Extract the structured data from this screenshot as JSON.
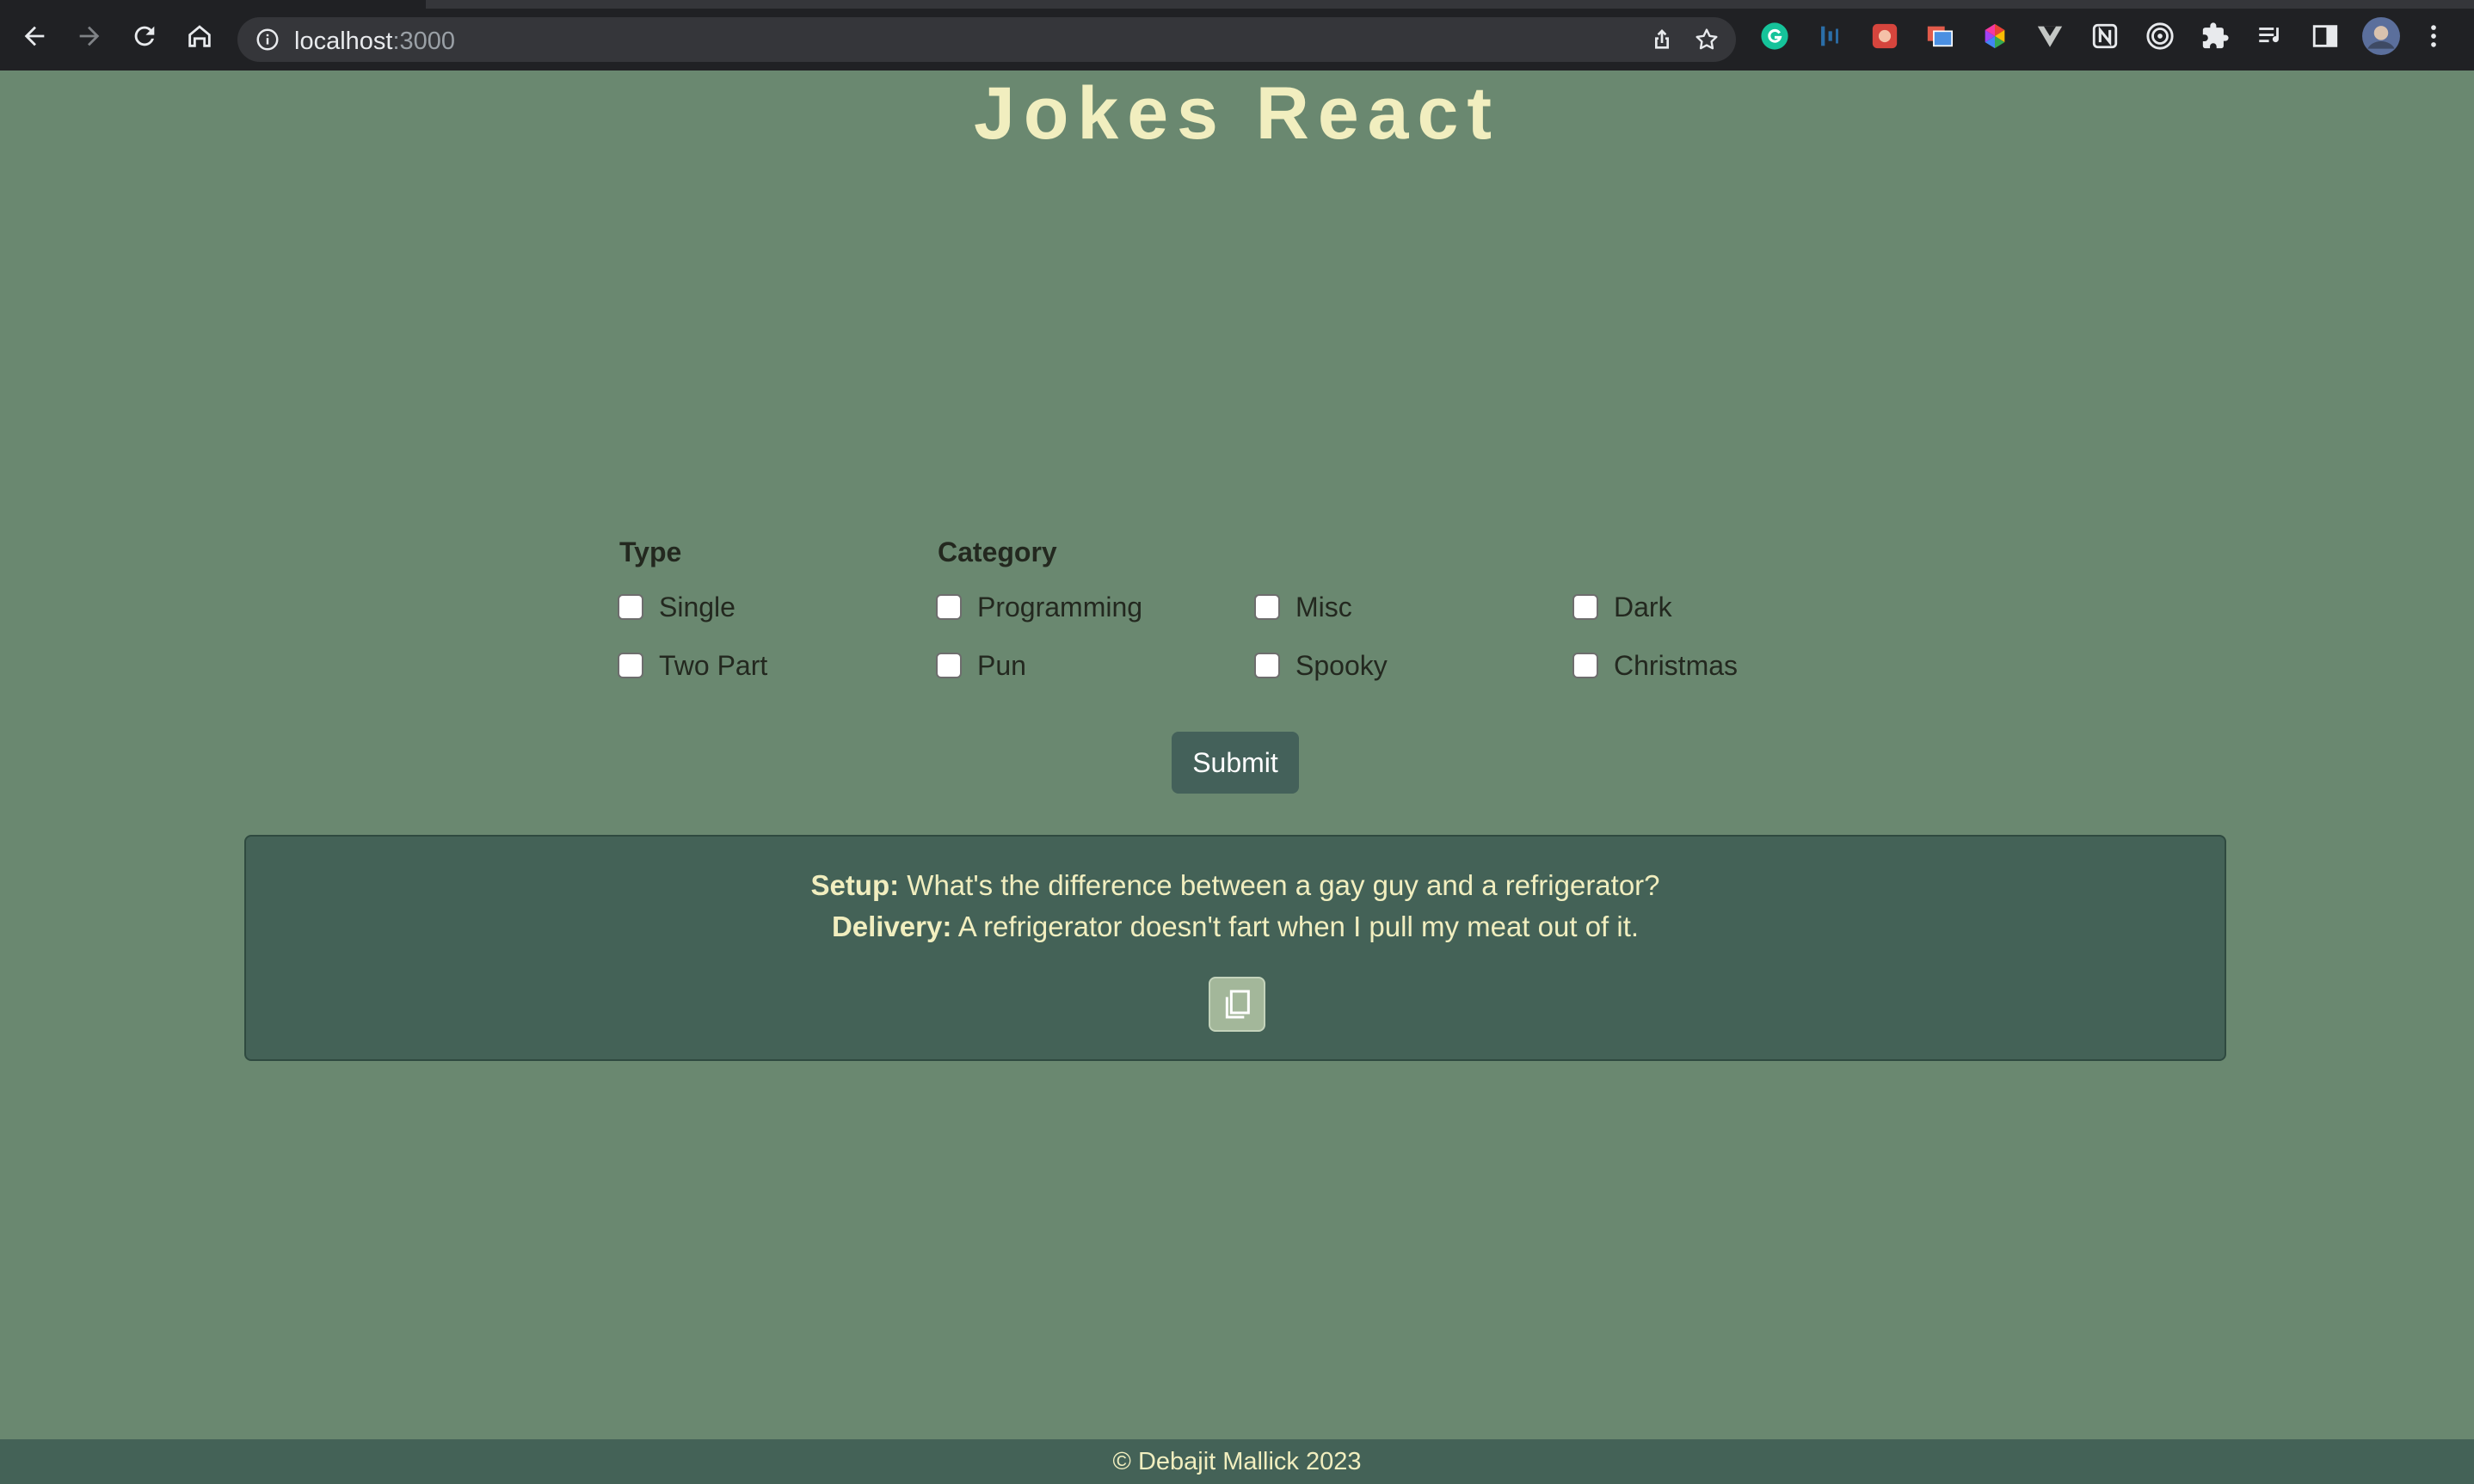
{
  "browser": {
    "url_host": "localhost",
    "url_port": ":3000",
    "extensions": [
      "grammarly-icon",
      "bars-extension-icon",
      "red-extension-icon",
      "copy-extension-icon",
      "color-wheel-icon",
      "vuetify-icon",
      "notion-icon",
      "target-icon",
      "puzzle-extensions-icon",
      "reading-list-icon",
      "side-panel-icon",
      "profile-avatar",
      "more-menu-icon"
    ]
  },
  "page": {
    "title": "Jokes React"
  },
  "filters": {
    "type_label": "Type",
    "category_label": "Category",
    "types": [
      "Single",
      "Two Part"
    ],
    "categories": [
      "Programming",
      "Misc",
      "Dark",
      "Pun",
      "Spooky",
      "Christmas"
    ]
  },
  "submit_label": "Submit",
  "joke": {
    "setup_label": "Setup:",
    "setup_text": " What's the difference between a gay guy and a refrigerator?",
    "delivery_label": "Delivery:",
    "delivery_text": " A refrigerator doesn't fart when I pull my meat out of it."
  },
  "footer": {
    "text": "© Debajit Mallick 2023"
  },
  "colors": {
    "page_bg": "#6a8870",
    "title": "#f1eebf",
    "card_bg": "#446257",
    "button_bg": "#44615a",
    "copy_button_bg": "#a3b79a"
  }
}
